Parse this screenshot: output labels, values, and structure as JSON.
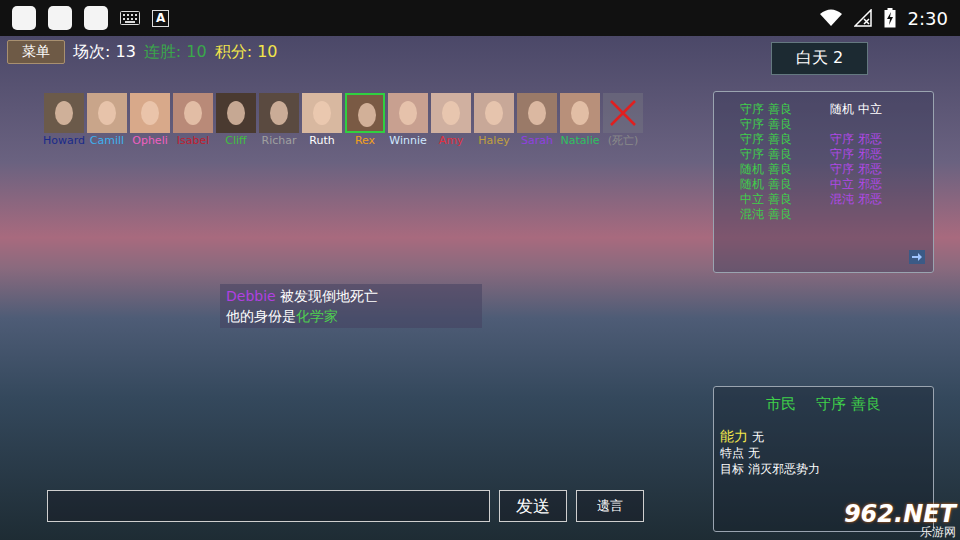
{
  "status_bar": {
    "badge": "A",
    "time": "2:30"
  },
  "menu_button": "菜单",
  "stats": [
    {
      "label": "场次: 13",
      "color": "#ffffff"
    },
    {
      "label": "连胜: 10",
      "color": "#3aa84a"
    },
    {
      "label": "积分: 10",
      "color": "#f2e64a"
    }
  ],
  "phase": "白天 2",
  "players": [
    {
      "kind": "portrait",
      "name": "Howard",
      "color": "#1a2a8a",
      "selected": false
    },
    {
      "kind": "portrait",
      "name": "Camill",
      "color": "#3db0f0",
      "selected": false
    },
    {
      "kind": "portrait",
      "name": "Opheli",
      "color": "#f060c0",
      "selected": false
    },
    {
      "kind": "portrait",
      "name": "Isabel",
      "color": "#c02030",
      "selected": false
    },
    {
      "kind": "portrait",
      "name": "Cliff",
      "color": "#40c040",
      "selected": false
    },
    {
      "kind": "portrait",
      "name": "Richar",
      "color": "#a0a0a0",
      "selected": false
    },
    {
      "kind": "portrait",
      "name": "Ruth",
      "color": "#ffffff",
      "selected": false
    },
    {
      "kind": "portrait",
      "name": "Rex",
      "color": "#f0a020",
      "selected": true
    },
    {
      "kind": "portrait",
      "name": "Winnie",
      "color": "#d0e8ff",
      "selected": false
    },
    {
      "kind": "portrait",
      "name": "Amy",
      "color": "#e03040",
      "selected": false
    },
    {
      "kind": "portrait",
      "name": "Haley",
      "color": "#c0a040",
      "selected": false
    },
    {
      "kind": "portrait",
      "name": "Sarah",
      "color": "#9040e0",
      "selected": false
    },
    {
      "kind": "portrait",
      "name": "Natalie",
      "color": "#30c060",
      "selected": false
    },
    {
      "kind": "dead",
      "name": "(死亡)",
      "color": "#8a8a8a",
      "selected": false
    }
  ],
  "roles_panel": {
    "left": [
      {
        "text": "守序 善良",
        "color": "#3fd04a"
      },
      {
        "text": "守序 善良",
        "color": "#3fd04a"
      },
      {
        "text": "守序 善良",
        "color": "#3fd04a"
      },
      {
        "text": "守序 善良",
        "color": "#3fd04a"
      },
      {
        "text": "随机 善良",
        "color": "#3fd04a"
      },
      {
        "text": "随机 善良",
        "color": "#3fd04a"
      },
      {
        "text": "中立 善良",
        "color": "#3fd04a"
      },
      {
        "text": "混沌 善良",
        "color": "#3fd04a"
      }
    ],
    "right": [
      {
        "text": "随机 中立",
        "color": "#ffffff"
      },
      {
        "text": "守序 邪恶",
        "color": "#b048e8"
      },
      {
        "text": "守序 邪恶",
        "color": "#b048e8"
      },
      {
        "text": "守序 邪恶",
        "color": "#b048e8"
      },
      {
        "text": "中立 邪恶",
        "color": "#b048e8"
      },
      {
        "text": "混沌 邪恶",
        "color": "#b048e8"
      }
    ]
  },
  "announcement": {
    "victim": "Debbie",
    "victim_color": "#b040e0",
    "died": "被发现倒地死亡",
    "identity_prefix": "他的身份是",
    "identity": "化学家",
    "identity_color": "#4fd04f"
  },
  "role_card": {
    "title": "市民",
    "alignment": "守序 善良",
    "rows": [
      {
        "label": "能力",
        "value": "无",
        "highlight": true
      },
      {
        "label": "特点",
        "value": "无",
        "highlight": false
      },
      {
        "label": "目标",
        "value": "消灭邪恶势力",
        "highlight": false
      }
    ]
  },
  "chat": {
    "send": "发送",
    "will": "遗言"
  },
  "watermark": {
    "brand": "962.NET",
    "sub": "乐游网"
  }
}
